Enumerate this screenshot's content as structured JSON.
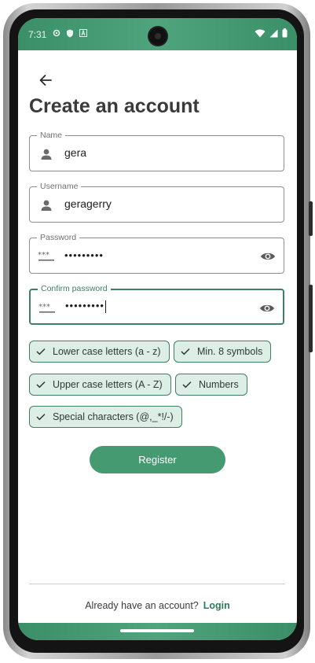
{
  "colors": {
    "accent": "#459a72",
    "chip_bg": "#ddeee6",
    "chip_border": "#3f7f62",
    "status_bar": "#3f956d"
  },
  "status_bar": {
    "time": "7:31",
    "left_icons": [
      "gear-icon",
      "shield-icon",
      "a-icon"
    ],
    "right_icons": [
      "wifi-icon",
      "signal-icon",
      "battery-icon"
    ]
  },
  "header": {
    "back_icon": "arrow-left-icon",
    "title": "Create an account"
  },
  "form": {
    "name": {
      "label": "Name",
      "value": "gera",
      "icon": "person-icon"
    },
    "username": {
      "label": "Username",
      "value": "geragerry",
      "icon": "person-icon"
    },
    "password": {
      "label": "Password",
      "value": "•••••••••",
      "icon": "password-icon",
      "toggle_icon": "eye-icon"
    },
    "confirm_password": {
      "label": "Confirm password",
      "value": "•••••••••",
      "icon": "password-icon",
      "toggle_icon": "eye-icon"
    }
  },
  "requirements": [
    {
      "label": "Lower case letters (a - z)",
      "met": true
    },
    {
      "label": "Min. 8 symbols",
      "met": true
    },
    {
      "label": "Upper case letters (A - Z)",
      "met": true
    },
    {
      "label": "Numbers",
      "met": true
    },
    {
      "label": "Special characters (@,_*!/-)",
      "met": true
    }
  ],
  "register_label": "Register",
  "footer": {
    "prompt": "Already have an account?",
    "login_label": "Login"
  }
}
